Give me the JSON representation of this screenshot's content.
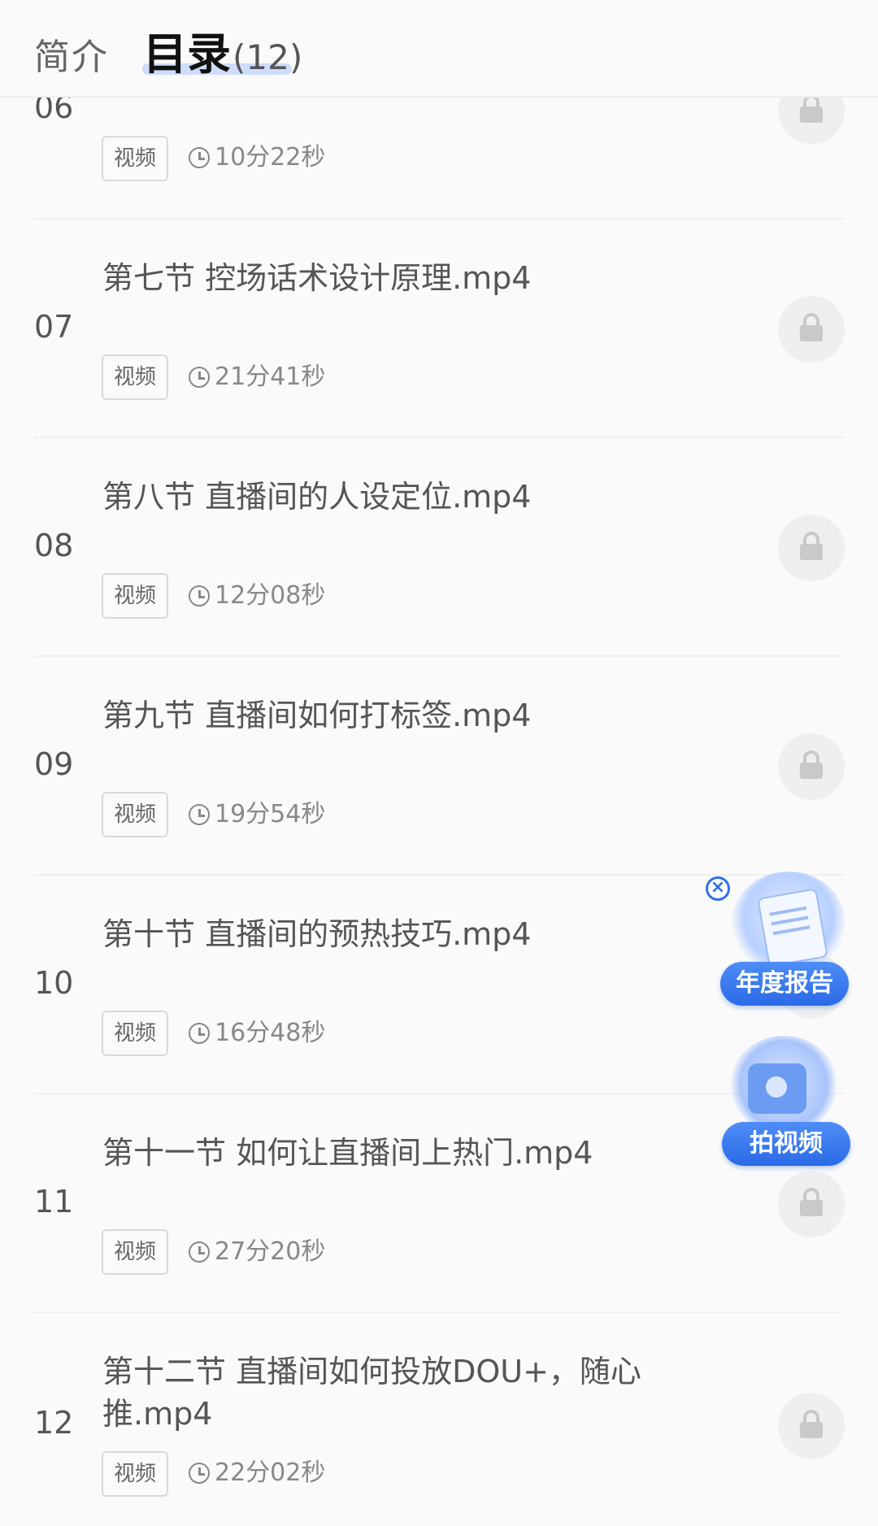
{
  "header": {
    "tab_intro": "简介",
    "tab_toc": "目录",
    "tab_toc_count": "(12)"
  },
  "items": [
    {
      "num": "06",
      "title": "",
      "tag": "视频",
      "duration": "10分22秒"
    },
    {
      "num": "07",
      "title": "第七节 控场话术设计原理.mp4",
      "tag": "视频",
      "duration": "21分41秒"
    },
    {
      "num": "08",
      "title": "第八节 直播间的人设定位.mp4",
      "tag": "视频",
      "duration": "12分08秒"
    },
    {
      "num": "09",
      "title": "第九节 直播间如何打标签.mp4",
      "tag": "视频",
      "duration": "19分54秒"
    },
    {
      "num": "10",
      "title": "第十节 直播间的预热技巧.mp4",
      "tag": "视频",
      "duration": "16分48秒"
    },
    {
      "num": "11",
      "title": "第十一节 如何让直播间上热门.mp4",
      "tag": "视频",
      "duration": "27分20秒"
    },
    {
      "num": "12",
      "title": "第十二节 直播间如何投放DOU+，随心推.mp4",
      "tag": "视频",
      "duration": "22分02秒"
    }
  ],
  "floating": {
    "report_label": "年度报告",
    "video_label": "拍视频"
  },
  "colors": {
    "accent": "#2f6fe8",
    "tab_underline": "#cfdcfb"
  }
}
